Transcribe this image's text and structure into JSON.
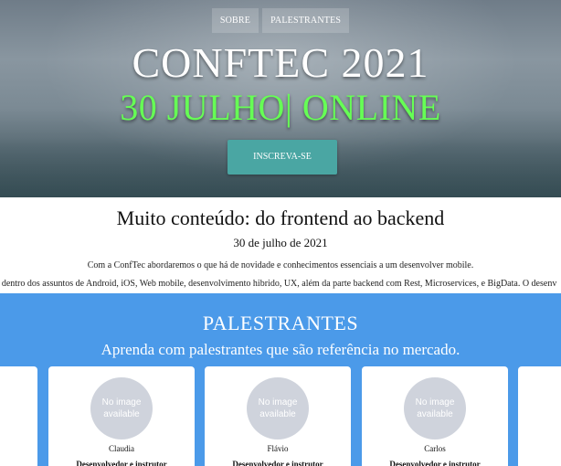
{
  "nav": {
    "items": [
      {
        "label": "SOBRE"
      },
      {
        "label": "PALESTRANTES"
      }
    ]
  },
  "hero": {
    "title": "CONFTEC 2021",
    "subtitle": "30 JULHO| ONLINE",
    "cta_label": "INSCREVA-SE"
  },
  "intro": {
    "title": "Muito conteúdo: do frontend ao backend",
    "date": "30 de julho de 2021",
    "paragraph1": "Com a ConfTec abordaremos o que há de novidade e conhecimentos essenciais a um desenvolver mobile.",
    "paragraph2": "r dentro dos assuntos de Android, iOS, Web mobile, desenvolvimento hibrido, UX, além da parte backend com Rest, Microservices, e BigData. O desenv"
  },
  "speakers": {
    "title": "PALESTRANTES",
    "subtitle": "Aprenda com palestrantes que são referência no mercado.",
    "placeholder_line1": "No image",
    "placeholder_line2": "available",
    "cards": [
      {
        "name": "Claudia",
        "role": "Desenvolvedor e instrutor"
      },
      {
        "name": "Flávio",
        "role": "Desenvolvedor e instrutor"
      },
      {
        "name": "Carlos",
        "role": "Desenvolvedor e instrutor"
      }
    ]
  },
  "colors": {
    "accent": "#4aa6a3",
    "speakers_bg": "#4b9ae9",
    "subtitle_green": "#66ff55"
  }
}
